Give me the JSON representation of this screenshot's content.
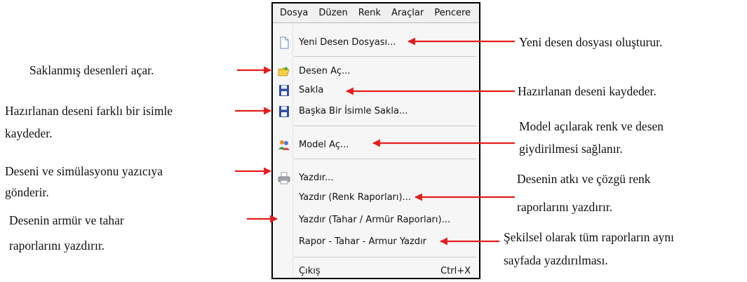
{
  "menubar": {
    "items": [
      "Dosya",
      "Düzen",
      "Renk",
      "Araçlar",
      "Pencere"
    ]
  },
  "menu": {
    "new_file": "Yeni Desen Dosyası...",
    "open_pattern": "Desen Aç...",
    "save": "Sakla",
    "save_as": "Başka Bir İsimle Sakla...",
    "open_model": "Model Aç...",
    "print": "Yazdır...",
    "print_color_reports": "Yazdır (Renk Raporları)...",
    "print_tahar_armur": "Yazdır (Tahar / Armür Raporları)...",
    "print_all": "Rapor - Tahar - Armur Yazdır",
    "exit": "Çıkış",
    "exit_shortcut": "Ctrl+X"
  },
  "notes": {
    "new_file": "Yeni desen dosyası oluşturur.",
    "open_pattern": "Saklanmış desenleri açar.",
    "save": "Hazırlanan deseni kaydeder.",
    "save_as_1": "Hazırlanan deseni farklı bir isimle",
    "save_as_2": "kaydeder.",
    "model_1": "Model açılarak renk ve desen",
    "model_2": "giydirilmesi sağlanır.",
    "print_1": "Deseni ve simülasyonu yazıcıya",
    "print_2": "gönderir.",
    "color_1": "Desenin atkı ve çözgü renk",
    "color_2": "raporlarını yazdırır.",
    "armur_1": "Desenin armür ve tahar",
    "armur_2": "raporlarını yazdırır.",
    "all_1": "Şekilsel olarak tüm raporların aynı",
    "all_2": "sayfada yazdırılması."
  },
  "colors": {
    "arrow": "#e41e1e",
    "menu_bg": "#f6f6f6",
    "menubar_bg": "#f0f0f0"
  }
}
